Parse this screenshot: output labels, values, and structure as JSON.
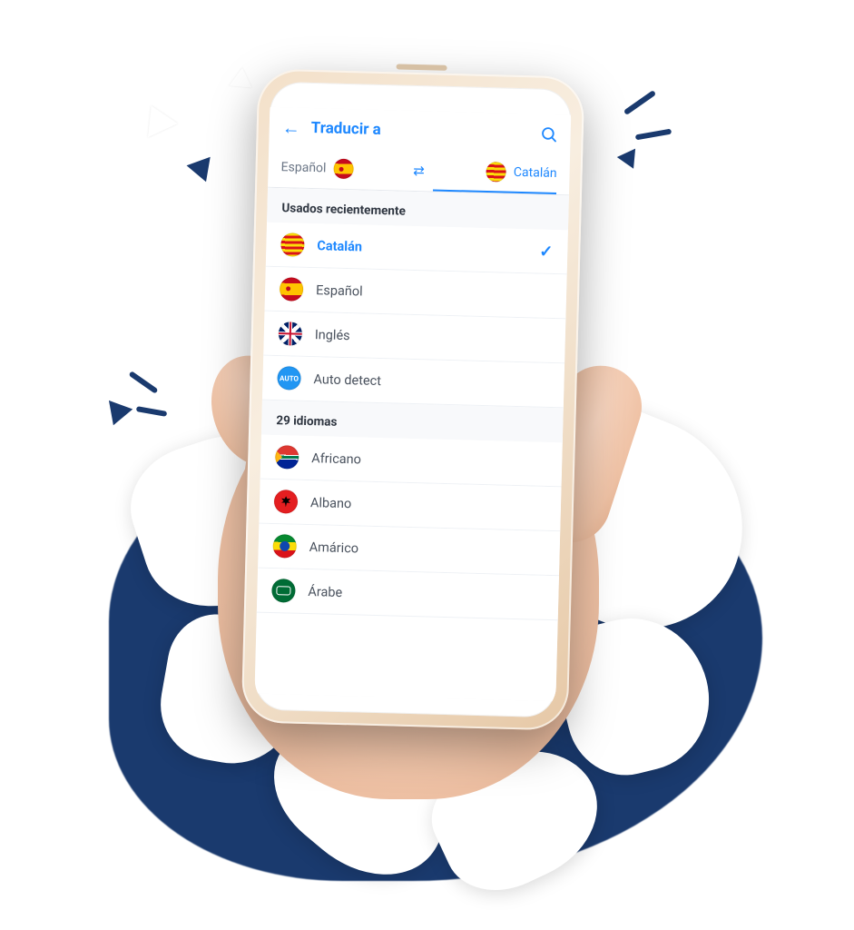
{
  "header": {
    "title": "Traducir a"
  },
  "lang_bar": {
    "source": "Español",
    "target": "Catalán"
  },
  "sections": {
    "recent_label": "Usados recientemente",
    "all_label": "29 idiomas"
  },
  "recent": [
    {
      "name": "Catalán",
      "flag": "ca",
      "selected": true
    },
    {
      "name": "Español",
      "flag": "es",
      "selected": false
    },
    {
      "name": "Inglés",
      "flag": "gb",
      "selected": false
    },
    {
      "name": "Auto detect",
      "flag": "auto",
      "selected": false
    }
  ],
  "all": [
    {
      "name": "Africano",
      "flag": "za"
    },
    {
      "name": "Albano",
      "flag": "al"
    },
    {
      "name": "Amárico",
      "flag": "et"
    },
    {
      "name": "Árabe",
      "flag": "ar"
    }
  ],
  "icons": {
    "auto_label": "AUTO"
  }
}
